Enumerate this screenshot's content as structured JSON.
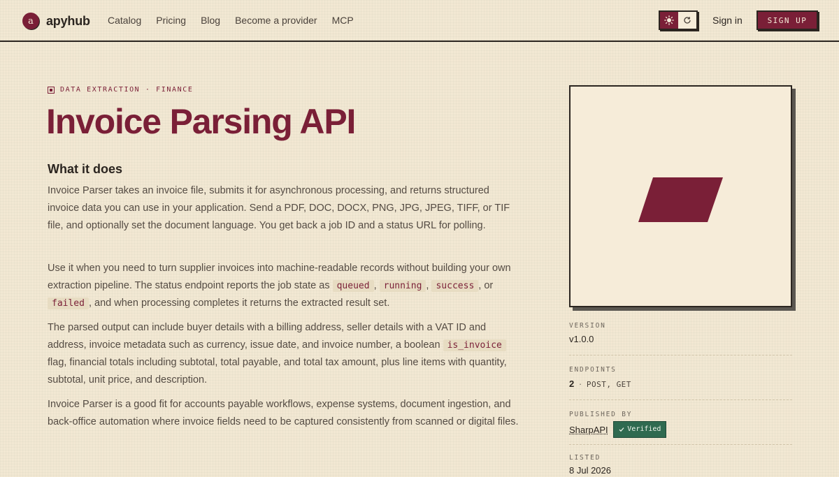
{
  "brand": {
    "logo_letter": "a",
    "name": "apyhub"
  },
  "nav": {
    "items": [
      {
        "label": "Catalog"
      },
      {
        "label": "Pricing"
      },
      {
        "label": "Blog"
      },
      {
        "label": "Become a provider"
      },
      {
        "label": "MCP"
      }
    ]
  },
  "header": {
    "signin_label": "Sign in",
    "signup_label": "SIGN UP"
  },
  "page": {
    "eyebrow": "DATA EXTRACTION · FINANCE",
    "title": "Invoice Parsing API",
    "section_heading": "What it does",
    "p1": "Invoice Parser takes an invoice file, submits it for asynchronous processing, and returns structured invoice data you can use in your application. Send a PDF, DOC, DOCX, PNG, JPG, JPEG, TIFF, or TIF file, and optionally set the document language. You get back a job ID and a status URL for polling.",
    "p2": {
      "before": "Use it when you need to turn supplier invoices into machine-readable records without building your own extraction pipeline. The status endpoint reports the job state as ",
      "code_1": "queued",
      "sep_1": ", ",
      "code_2": "running",
      "sep_2": ", ",
      "code_3": "success",
      "sep_3": ", or ",
      "code_4": "failed",
      "after": ", and when processing completes it returns the extracted result set."
    },
    "p3": {
      "before": "The parsed output can include buyer details with a billing address, seller details with a VAT ID and address, invoice metadata such as currency, issue date, and invoice number, a boolean ",
      "code_1": "is_invoice",
      "after": " flag, financial totals including subtotal, total payable, and total tax amount, plus line items with quantity, subtotal, unit price, and description."
    },
    "p4": "Invoice Parser is a good fit for accounts payable workflows, expense systems, document ingestion, and back-office automation where invoice fields need to be captured consistently from scanned or digital files."
  },
  "sidebar": {
    "version_label": "VERSION",
    "version_value": "v1.0.0",
    "endpoints_label": "ENDPOINTS",
    "endpoints_count": "2",
    "endpoints_sep": "·",
    "endpoints_methods": "POST, GET",
    "published_label": "PUBLISHED BY",
    "publisher": "SharpAPI",
    "verified_label": "Verified",
    "listed_label": "LISTED",
    "listed_value": "8 Jul 2026"
  },
  "colors": {
    "background": "#f2e8d3",
    "accent": "#7a1f37",
    "verified": "#2f6a50",
    "ink": "#2b2520"
  },
  "icons": [
    "sun-icon",
    "refresh-icon",
    "check-icon",
    "folder-icon"
  ]
}
